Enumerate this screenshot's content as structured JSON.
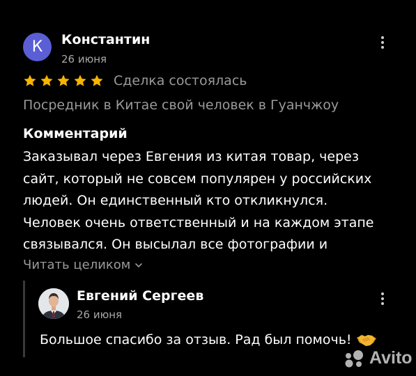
{
  "review": {
    "avatar_letter": "К",
    "author": "Константин",
    "date": "26 июня",
    "rating": 5,
    "rating_max": 5,
    "deal_status": "Сделка состоялась",
    "service": "Посредник в Китае свой человек в Гуанчжоу",
    "comment_heading": "Комментарий",
    "comment_lines": [
      "Заказывал через Евгения из китая товар, через",
      "сайт, который не совсем популярен у российских",
      "людей. Он единственный кто откликнулся.",
      "Человек очень ответственный и на каждом этапе",
      "связывался. Он высылал все фотографии и"
    ],
    "read_more": "Читать целиком",
    "star_color": "#f7b500",
    "avatar_color": "#5a5fd6"
  },
  "reply": {
    "author": "Евгений Сергеев",
    "date": "26 июня",
    "text": "Большое спасибо за отзыв. Рад был помочь!",
    "emoji": "handshake-icon"
  },
  "watermark": {
    "text": "Avito"
  }
}
